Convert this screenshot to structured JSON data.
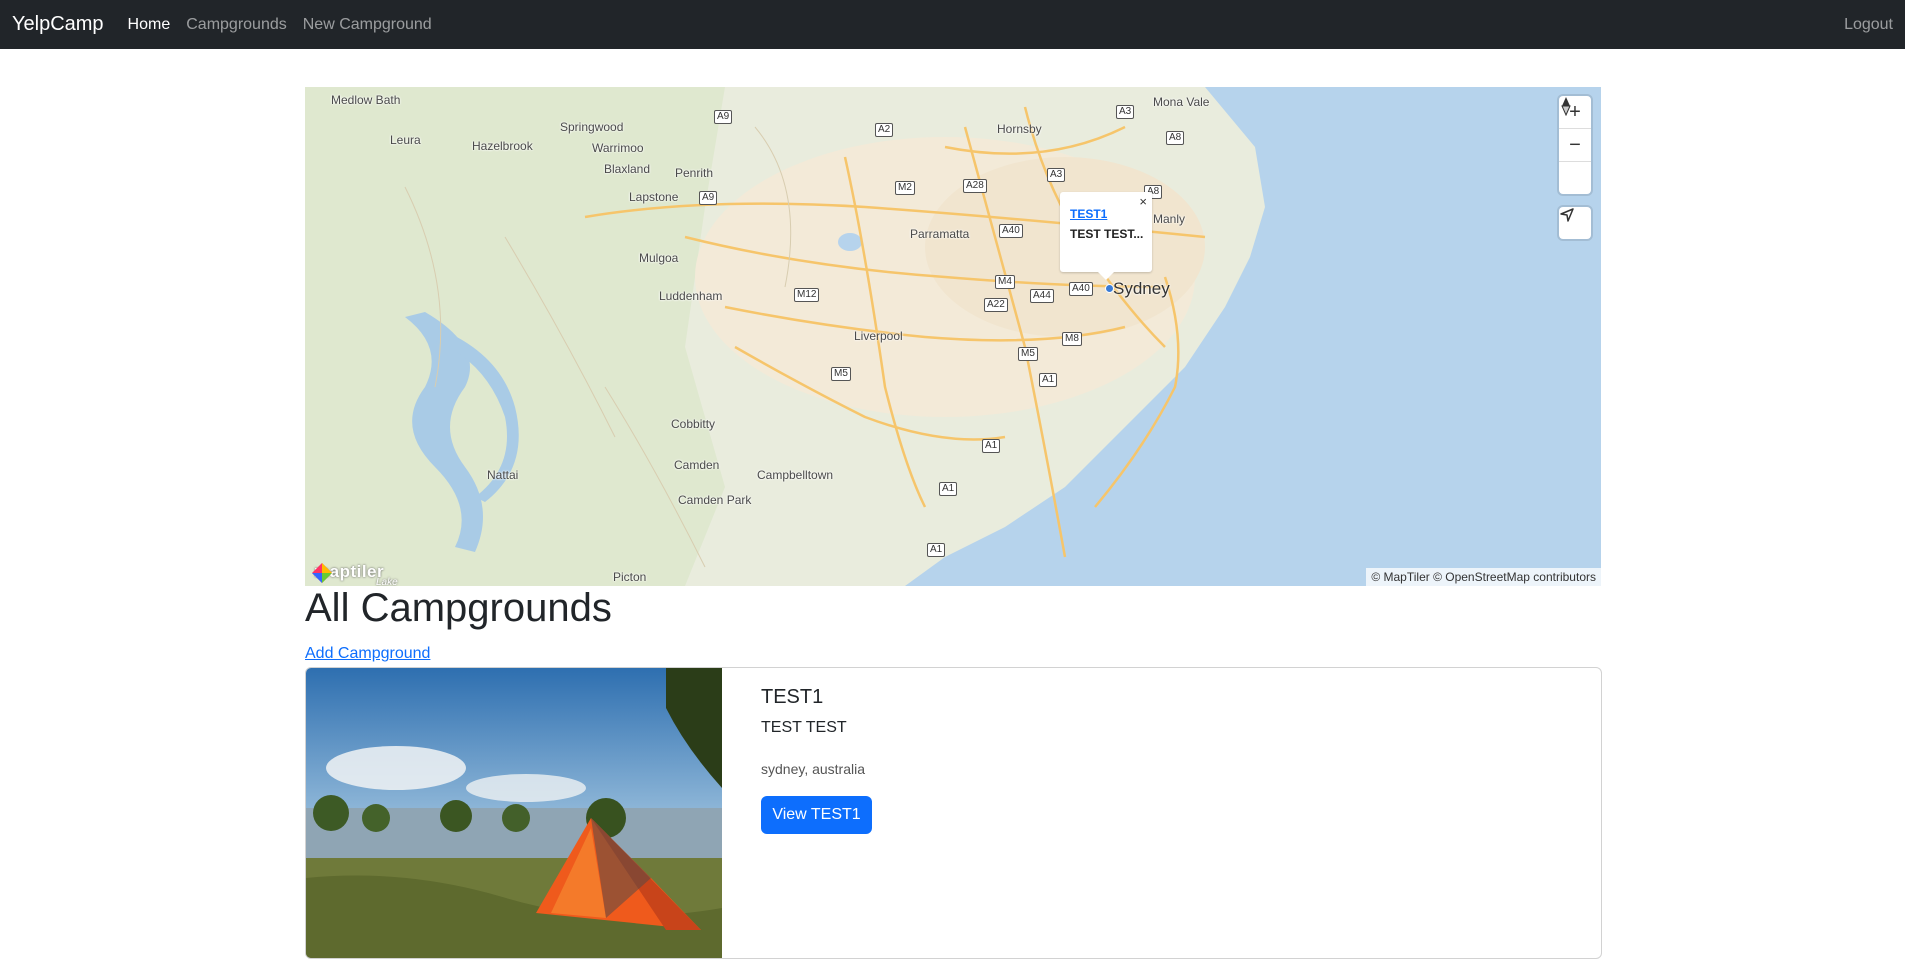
{
  "navbar": {
    "brand": "YelpCamp",
    "links": [
      "Home",
      "Campgrounds",
      "New Campground"
    ],
    "logout": "Logout"
  },
  "map": {
    "popup": {
      "title": "TEST1",
      "text": "TEST TEST...",
      "close": "×"
    },
    "places": [
      "Medlow Bath",
      "Leura",
      "Hazelbrook",
      "Springwood",
      "Warrimoo",
      "Blaxland",
      "Penrith",
      "Lapstone",
      "Mulgoa",
      "Luddenham",
      "Parramatta",
      "Hornsby",
      "Mona Vale",
      "Manly",
      "Liverpool",
      "Sydney",
      "Cobbitty",
      "Camden",
      "Campbelltown",
      "Camden Park",
      "Nattai",
      "Picton"
    ],
    "shields": [
      "A9",
      "A2",
      "A3",
      "A8",
      "M2",
      "A28",
      "A3",
      "A8",
      "A9",
      "A40",
      "M12",
      "M4",
      "A22",
      "A44",
      "A40",
      "M8",
      "M5",
      "M5",
      "A1",
      "A1",
      "A1",
      "A1"
    ],
    "controls": {
      "zoom_in": "+",
      "zoom_out": "−"
    },
    "logo": "maptiler",
    "logo_sub": "Lake",
    "attribution": "© MapTiler © OpenStreetMap contributors"
  },
  "page_title": "All Campgrounds",
  "add_link": "Add Campground",
  "campgrounds": [
    {
      "title": "TEST1",
      "description": "TEST TEST",
      "location": "sydney, australia",
      "button": "View TEST1"
    }
  ]
}
